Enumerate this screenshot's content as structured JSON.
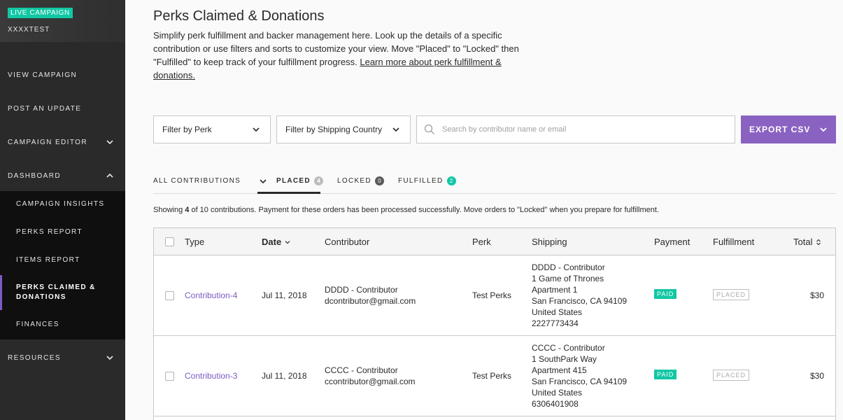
{
  "sidebar": {
    "live_badge": "LIVE CAMPAIGN",
    "campaign_name": "XXXXTEST",
    "items": [
      {
        "label": "VIEW CAMPAIGN"
      },
      {
        "label": "POST AN UPDATE"
      },
      {
        "label": "CAMPAIGN EDITOR"
      },
      {
        "label": "DASHBOARD"
      },
      {
        "label": "RESOURCES"
      }
    ],
    "subitems": [
      {
        "label": "CAMPAIGN INSIGHTS"
      },
      {
        "label": "PERKS REPORT"
      },
      {
        "label": "ITEMS REPORT"
      },
      {
        "label": "PERKS CLAIMED & DONATIONS"
      },
      {
        "label": "FINANCES"
      }
    ]
  },
  "page": {
    "title": "Perks Claimed & Donations",
    "intro": "Simplify perk fulfillment and backer management here. Look up the details of a specific contribution or use filters and sorts to customize your view. Move \"Placed\" to \"Locked\" then \"Fulfilled\" to keep track of your fulfillment progress. ",
    "intro_link": "Learn more about perk fulfillment & donations."
  },
  "filters": {
    "perk": "Filter by Perk",
    "country": "Filter by Shipping Country",
    "search_placeholder": "Search by contributor name or email",
    "export": "EXPORT CSV"
  },
  "tabs": [
    {
      "label": "ALL CONTRIBUTIONS"
    },
    {
      "label": "PLACED",
      "count": "4"
    },
    {
      "label": "LOCKED",
      "count": "0"
    },
    {
      "label": "FULFILLED",
      "count": "2"
    }
  ],
  "showing": {
    "prefix": "Showing ",
    "count": "4",
    "suffix": " of 10 contributions. Payment for these orders has been processed successfully. Move orders to \"Locked\" when you prepare for fulfillment."
  },
  "table": {
    "headers": {
      "type": "Type",
      "date": "Date",
      "contributor": "Contributor",
      "perk": "Perk",
      "shipping": "Shipping",
      "payment": "Payment",
      "fulfillment": "Fulfillment",
      "total": "Total"
    },
    "rows": [
      {
        "type": "Contribution-4",
        "date": "Jul 11, 2018",
        "contributor_name": "DDDD - Contributor",
        "contributor_email": "dcontributor@gmail.com",
        "perk": "Test Perks",
        "shipping": [
          "DDDD - Contributor",
          "1 Game of Thrones",
          "Apartment 1",
          "San Francisco, CA 94109",
          "United States",
          "2227773434"
        ],
        "payment": "PAID",
        "fulfillment": "PLACED",
        "total": "$30"
      },
      {
        "type": "Contribution-3",
        "date": "Jul 11, 2018",
        "contributor_name": "CCCC - Contributor",
        "contributor_email": "ccontributor@gmail.com",
        "perk": "Test Perks",
        "shipping": [
          "CCCC - Contributor",
          "1 SouthPark Way",
          "Apartment 415",
          "San Francisco, CA 94109",
          "United States",
          "6306401908"
        ],
        "payment": "PAID",
        "fulfillment": "PLACED",
        "total": "$30"
      }
    ]
  },
  "colors": {
    "accent": "#8a63c2",
    "success": "#11c7a4",
    "sidebar": "#2a2a2a"
  }
}
